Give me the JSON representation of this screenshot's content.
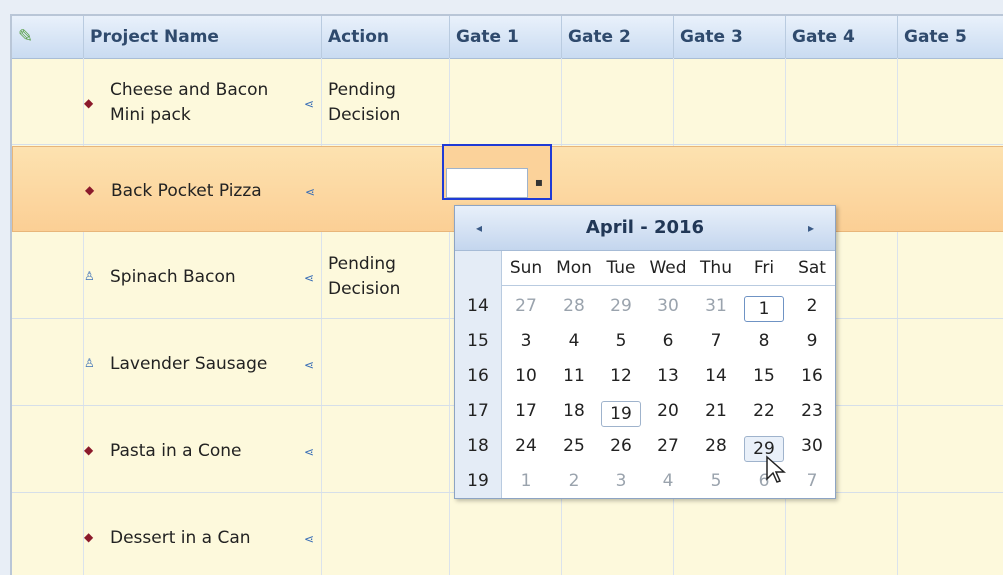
{
  "header": {
    "edit_icon": "pencil-icon",
    "columns": [
      "Project Name",
      "Action",
      "Gate 1",
      "Gate 2",
      "Gate 3",
      "Gate 4",
      "Gate 5"
    ]
  },
  "rows": [
    {
      "name_line1": "Cheese and Bacon",
      "name_line2": "Mini pack",
      "icon": "flag-icon",
      "action_line1": "Pending",
      "action_line2": "Decision"
    },
    {
      "name_line1": "Back Pocket Pizza",
      "name_line2": "",
      "icon": "flag-icon",
      "action_line1": "",
      "action_line2": ""
    },
    {
      "name_line1": "Spinach Bacon",
      "name_line2": "",
      "icon": "person-icon",
      "action_line1": "Pending",
      "action_line2": "Decision"
    },
    {
      "name_line1": "Lavender Sausage",
      "name_line2": "",
      "icon": "person-icon",
      "action_line1": "",
      "action_line2": ""
    },
    {
      "name_line1": "Pasta in a Cone",
      "name_line2": "",
      "icon": "flag-icon",
      "action_line1": "",
      "action_line2": ""
    },
    {
      "name_line1": "Dessert in a Can",
      "name_line2": "",
      "icon": "flag-icon",
      "action_line1": "",
      "action_line2": ""
    }
  ],
  "calendar": {
    "title": "April - 2016",
    "prev": "◂",
    "next": "▸",
    "days_of_week": [
      "Sun",
      "Mon",
      "Tue",
      "Wed",
      "Thu",
      "Fri",
      "Sat"
    ],
    "weeks": [
      {
        "num": "14",
        "days": [
          "27",
          "28",
          "29",
          "30",
          "31",
          "1",
          "2"
        ]
      },
      {
        "num": "15",
        "days": [
          "3",
          "4",
          "5",
          "6",
          "7",
          "8",
          "9"
        ]
      },
      {
        "num": "16",
        "days": [
          "10",
          "11",
          "12",
          "13",
          "14",
          "15",
          "16"
        ]
      },
      {
        "num": "17",
        "days": [
          "17",
          "18",
          "19",
          "20",
          "21",
          "22",
          "23"
        ]
      },
      {
        "num": "18",
        "days": [
          "24",
          "25",
          "26",
          "27",
          "28",
          "29",
          "30"
        ]
      },
      {
        "num": "19",
        "days": [
          "1",
          "2",
          "3",
          "4",
          "5",
          "6",
          "7"
        ]
      }
    ]
  }
}
